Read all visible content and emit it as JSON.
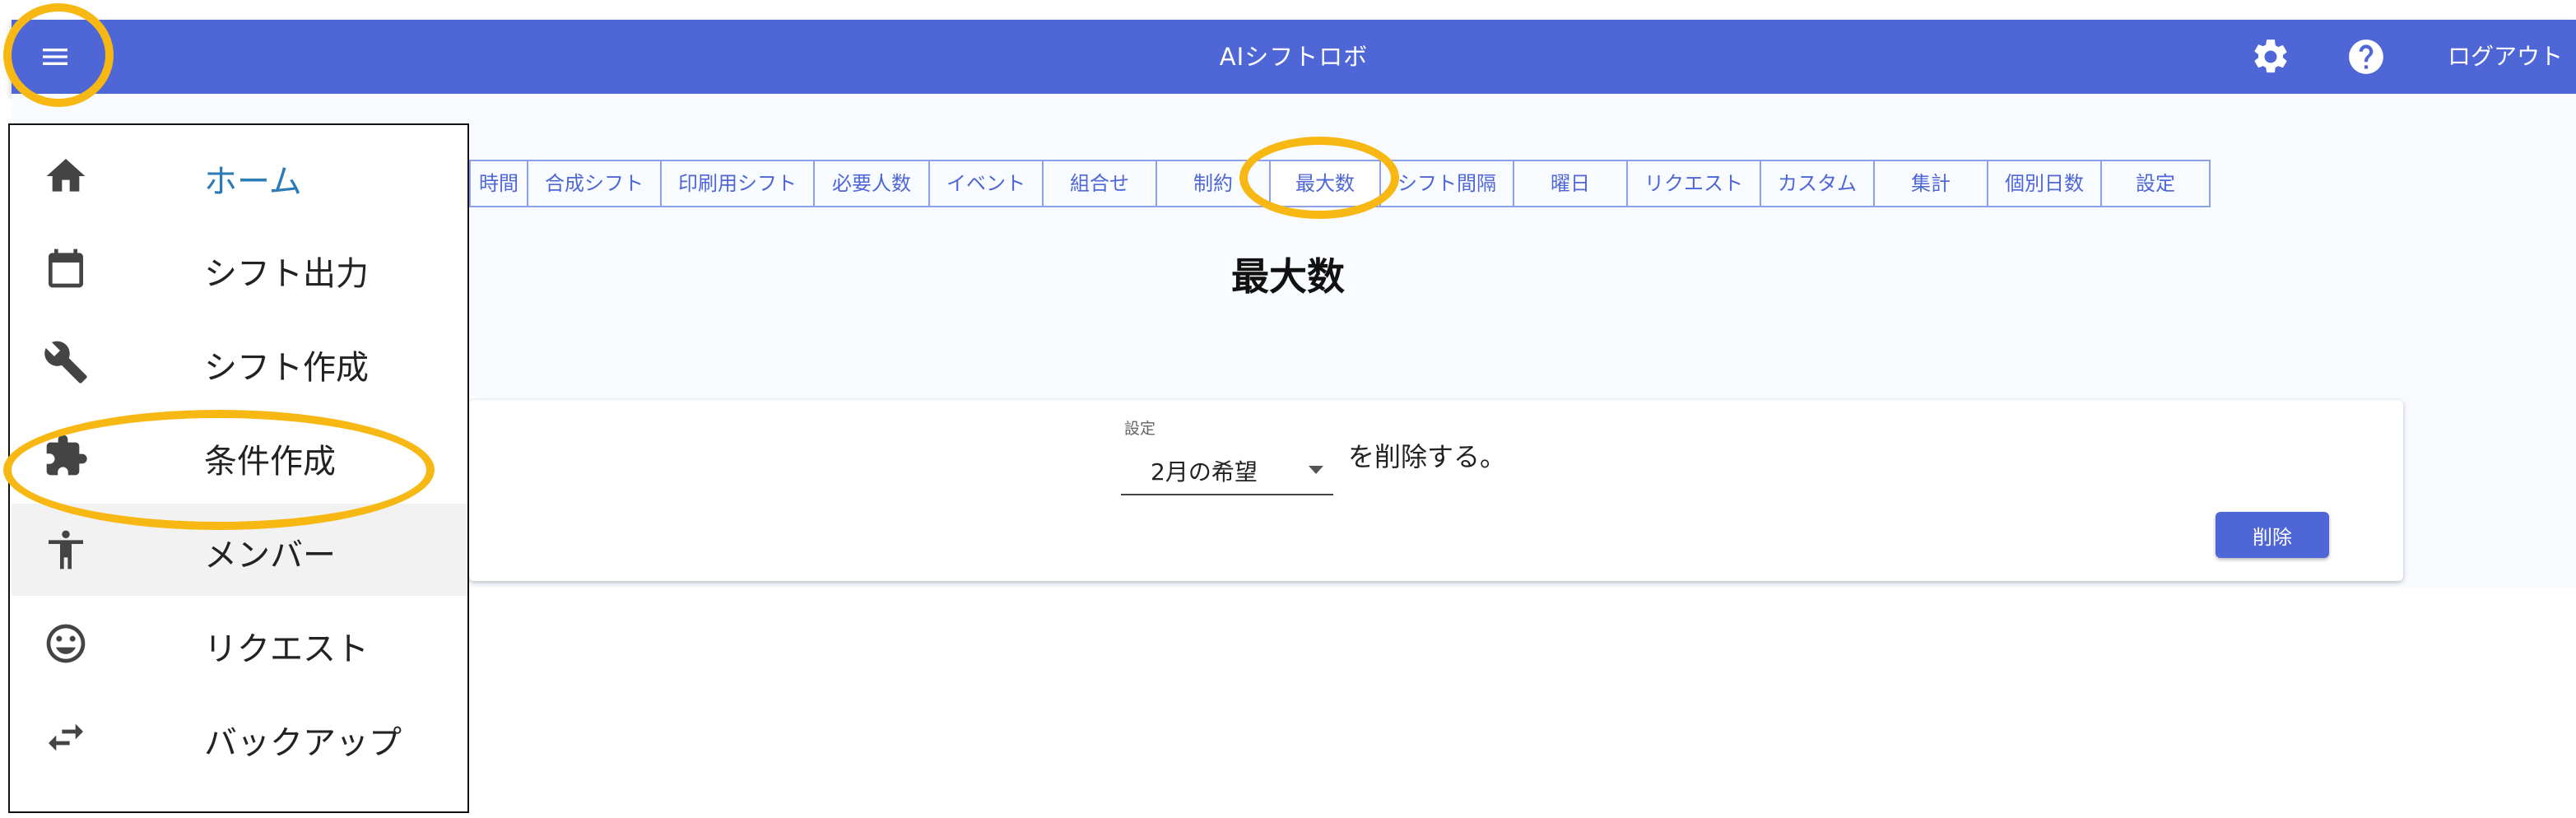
{
  "app": {
    "title": "AIシフトロボ",
    "logout_label": "ログアウト"
  },
  "colors": {
    "primary": "#4f67d6",
    "highlight": "#f7b813",
    "home_text": "#2b7bb9"
  },
  "icons": {
    "menu": "hamburger-menu-icon",
    "settings": "gear-icon",
    "help": "question-circle-icon"
  },
  "tabs": [
    {
      "label": "時間"
    },
    {
      "label": "合成シフト"
    },
    {
      "label": "印刷用シフト"
    },
    {
      "label": "必要人数"
    },
    {
      "label": "イベント"
    },
    {
      "label": "組合せ"
    },
    {
      "label": "制約"
    },
    {
      "label": "最大数",
      "active": true
    },
    {
      "label": "シフト間隔"
    },
    {
      "label": "曜日"
    },
    {
      "label": "リクエスト"
    },
    {
      "label": "カスタム"
    },
    {
      "label": "集計"
    },
    {
      "label": "個別日数"
    },
    {
      "label": "設定"
    }
  ],
  "main": {
    "page_title": "最大数",
    "select_label": "設定",
    "select_value": "2月の希望",
    "delete_text": "を削除する。",
    "delete_button": "削除"
  },
  "drawer": {
    "items": [
      {
        "label": "ホーム",
        "icon": "home-icon"
      },
      {
        "label": "シフト出力",
        "icon": "calendar-icon"
      },
      {
        "label": "シフト作成",
        "icon": "wrench-icon"
      },
      {
        "label": "条件作成",
        "icon": "puzzle-icon"
      },
      {
        "label": "メンバー",
        "icon": "accessibility-icon"
      },
      {
        "label": "リクエスト",
        "icon": "smiley-icon"
      },
      {
        "label": "バックアップ",
        "icon": "swap-arrows-icon"
      }
    ]
  }
}
